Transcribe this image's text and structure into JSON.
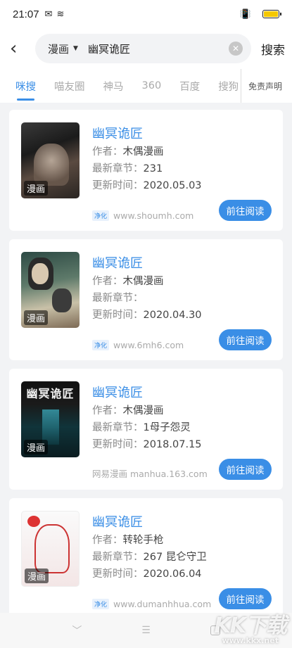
{
  "status_bar": {
    "time": "21:07"
  },
  "header": {
    "category": "漫画",
    "query": "幽冥诡匠",
    "search_label": "搜索"
  },
  "tabs": [
    {
      "label": "咪搜",
      "active": true
    },
    {
      "label": "喵友圈"
    },
    {
      "label": "神马"
    },
    {
      "label": "360"
    },
    {
      "label": "百度"
    },
    {
      "label": "搜狗"
    }
  ],
  "disclaimer": "免责声明",
  "results": [
    {
      "title": "幽冥诡匠",
      "author_label": "作者：",
      "author": "木偶漫画",
      "chapter_label": "最新章节：",
      "chapter": "231",
      "updated_label": "更新时间：",
      "updated": "2020.05.03",
      "badge": "净化",
      "source": "www.shoumh.com",
      "tag": "漫画",
      "button": "前往阅读"
    },
    {
      "title": "幽冥诡匠",
      "author_label": "作者：",
      "author": "木偶漫画",
      "chapter_label": "最新章节：",
      "chapter": "",
      "updated_label": "更新时间：",
      "updated": "2020.04.30",
      "badge": "净化",
      "source": "www.6mh6.com",
      "tag": "漫画",
      "button": "前往阅读"
    },
    {
      "title": "幽冥诡匠",
      "author_label": "作者：",
      "author": "木偶漫画",
      "chapter_label": "最新章节：",
      "chapter": "1母子怨灵",
      "updated_label": "更新时间：",
      "updated": "2018.07.15",
      "badge": "",
      "source": "网易漫画 manhua.163.com",
      "tag": "漫画",
      "cover_title": "幽冥诡匠",
      "button": "前往阅读"
    },
    {
      "title": "幽冥诡匠",
      "author_label": "作者：",
      "author": "转轮手枪",
      "chapter_label": "最新章节：",
      "chapter": "267 昆仑守卫",
      "updated_label": "更新时间：",
      "updated": "2020.06.04",
      "badge": "净化",
      "source": "www.dumanhhua.com",
      "tag": "漫画",
      "button": "前往阅读"
    }
  ],
  "watermark": {
    "big": "KK下载",
    "small": "www.kkx.net"
  },
  "colors": {
    "accent": "#3a8ee6",
    "battery": "#f5c800"
  }
}
